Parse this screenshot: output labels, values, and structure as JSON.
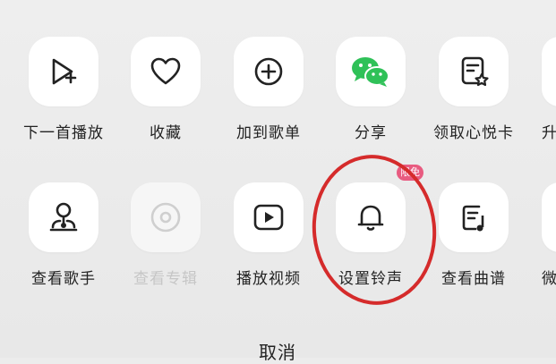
{
  "share_sheet": {
    "row1": [
      {
        "label": "下一首播放",
        "icon": "play-next-icon"
      },
      {
        "label": "收藏",
        "icon": "heart-icon"
      },
      {
        "label": "加到歌单",
        "icon": "plus-circle-icon"
      },
      {
        "label": "分享",
        "icon": "wechat-icon"
      },
      {
        "label": "领取心悦卡",
        "icon": "card-star-icon"
      },
      {
        "label": "升",
        "icon": "partial-icon"
      }
    ],
    "row2": [
      {
        "label": "查看歌手",
        "icon": "singer-icon"
      },
      {
        "label": "查看专辑",
        "icon": "album-disc-icon",
        "disabled": true
      },
      {
        "label": "播放视频",
        "icon": "play-video-icon"
      },
      {
        "label": "设置铃声",
        "icon": "bell-icon"
      },
      {
        "label": "查看曲谱",
        "icon": "music-score-icon"
      },
      {
        "label": "微",
        "icon": "partial-icon"
      }
    ],
    "badge": "限免",
    "cancel_label": "取消"
  },
  "colors": {
    "background": "#ececec",
    "tile": "#ffffff",
    "highlight": "#d52b2b",
    "badge": "#e85b80",
    "wechat_green": "#2fc158"
  }
}
